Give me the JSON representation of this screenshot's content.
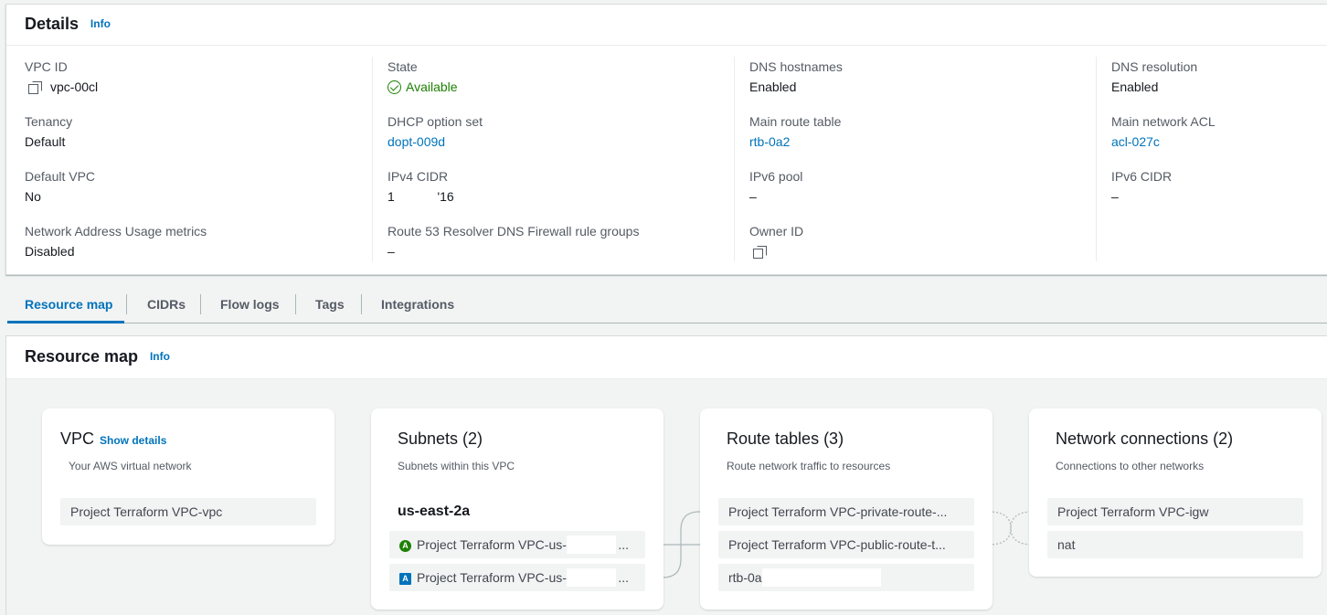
{
  "details": {
    "title": "Details",
    "info": "Info",
    "columns": [
      [
        {
          "key": "VPC ID",
          "value": "vpc-00cl",
          "style": "copy"
        },
        {
          "key": "Tenancy",
          "value": "Default"
        },
        {
          "key": "Default VPC",
          "value": "No"
        },
        {
          "key": "Network Address Usage metrics",
          "value": "Disabled"
        }
      ],
      [
        {
          "key": "State",
          "value": "Available",
          "style": "status"
        },
        {
          "key": "DHCP option set",
          "value": "dopt-009d",
          "style": "link"
        },
        {
          "key": "IPv4 CIDR",
          "value": "1            '16"
        },
        {
          "key": "Route 53 Resolver DNS Firewall rule groups",
          "value": "–"
        }
      ],
      [
        {
          "key": "DNS hostnames",
          "value": "Enabled"
        },
        {
          "key": "Main route table",
          "value": "rtb-0a2",
          "style": "link"
        },
        {
          "key": "IPv6 pool",
          "value": "–"
        },
        {
          "key": "Owner ID",
          "value": "",
          "style": "copy"
        }
      ],
      [
        {
          "key": "DNS resolution",
          "value": "Enabled"
        },
        {
          "key": "Main network ACL",
          "value": "acl-027c",
          "style": "link"
        },
        {
          "key": "IPv6 CIDR",
          "value": "–"
        }
      ]
    ]
  },
  "tabs": [
    "Resource map",
    "CIDRs",
    "Flow logs",
    "Tags",
    "Integrations"
  ],
  "resource_map": {
    "title": "Resource map",
    "info": "Info",
    "vpc": {
      "title": "VPC",
      "show_details": "Show details",
      "subtitle": "Your AWS virtual network",
      "items": [
        "Project Terraform VPC-vpc"
      ]
    },
    "subnets": {
      "title": "Subnets (2)",
      "subtitle": "Subnets within this VPC",
      "az": "us-east-2a",
      "items": [
        {
          "badge": "A",
          "text": "Project Terraform VPC-us-",
          "ellipsis": "..."
        },
        {
          "badge": "A",
          "text": "Project Terraform VPC-us-",
          "ellipsis": "..."
        }
      ]
    },
    "route_tables": {
      "title": "Route tables (3)",
      "subtitle": "Route network traffic to resources",
      "items": [
        "Project Terraform VPC-private-route-...",
        "Project Terraform VPC-public-route-t...",
        "rtb-0a"
      ]
    },
    "network_connections": {
      "title": "Network connections (2)",
      "subtitle": "Connections to other networks",
      "items": [
        "Project Terraform VPC-igw",
        "nat"
      ]
    }
  },
  "colors": {
    "link": "#0073bb",
    "available": "#1d8102",
    "text": "#16191f",
    "muted": "#545b64"
  }
}
